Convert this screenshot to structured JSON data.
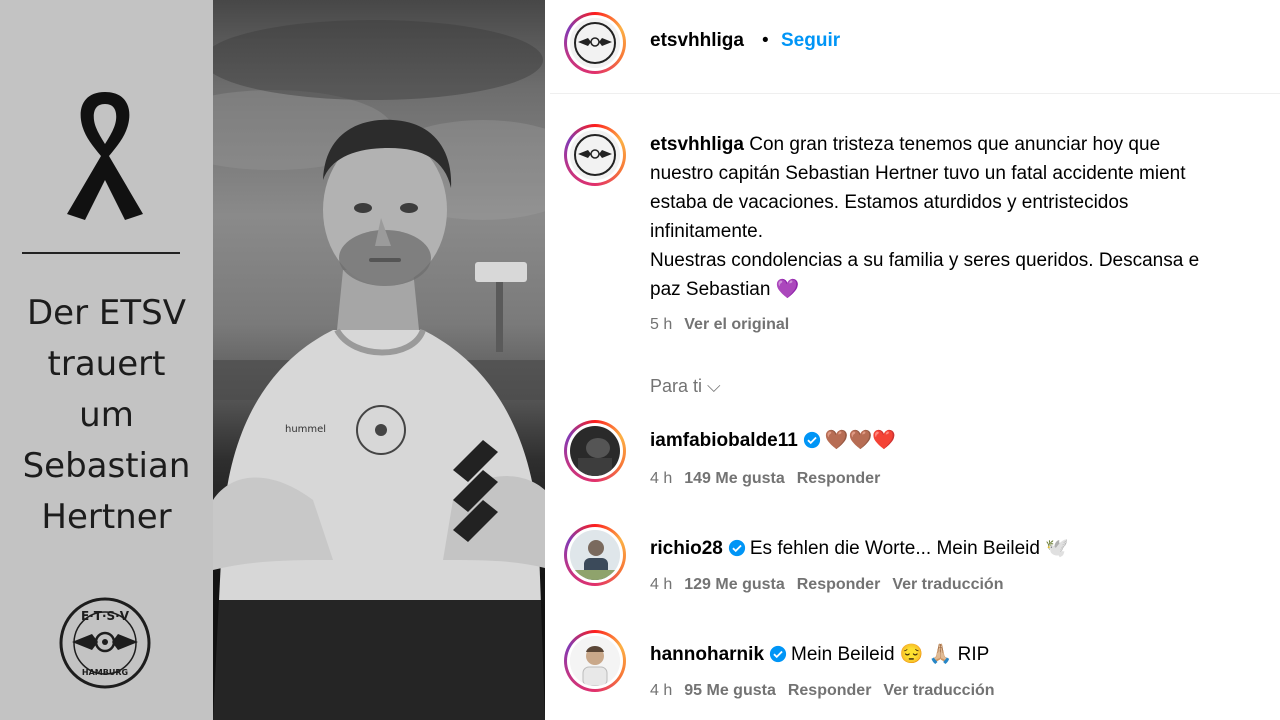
{
  "post_image": {
    "mourning_text": [
      "Der ETSV",
      "trauert",
      "um",
      "Sebastian",
      "Hertner"
    ],
    "logo_text": {
      "top": "E·T·S·V",
      "bottom": "HAMBURG"
    },
    "jersey_brand": "hummel"
  },
  "header": {
    "username": "etsvhhliga",
    "separator": "•",
    "follow_label": "Seguir"
  },
  "caption": {
    "username": "etsvhhliga",
    "lines": [
      "Con gran tristeza tenemos que anunciar hoy que",
      "nuestro capitán Sebastian Hertner tuvo un fatal accidente mient",
      "estaba de vacaciones. Estamos aturdidos y entristecidos",
      "infinitamente.",
      "Nuestras condolencias a su familia y seres queridos. Descansa e",
      "paz Sebastian 💜"
    ],
    "time": "5 h",
    "see_original": "Ver el original"
  },
  "for_you": {
    "label": "Para ti",
    "chevron": "⌵"
  },
  "comments": [
    {
      "username": "iamfabiobalde11",
      "text": "🤎🤎❤️",
      "time": "4 h",
      "likes": "149 Me gusta",
      "reply": "Responder",
      "translate": ""
    },
    {
      "username": "richio28",
      "text": "Es fehlen die Worte... Mein Beileid 🕊️",
      "time": "4 h",
      "likes": "129 Me gusta",
      "reply": "Responder",
      "translate": "Ver traducción"
    },
    {
      "username": "hannoharnik",
      "text": "Mein Beileid 😔 🙏🏼 RIP",
      "time": "4 h",
      "likes": "95 Me gusta",
      "reply": "Responder",
      "translate": "Ver traducción"
    }
  ],
  "colors": {
    "link_blue": "#0095f6",
    "muted": "#737373",
    "verified": "#0095f6"
  }
}
